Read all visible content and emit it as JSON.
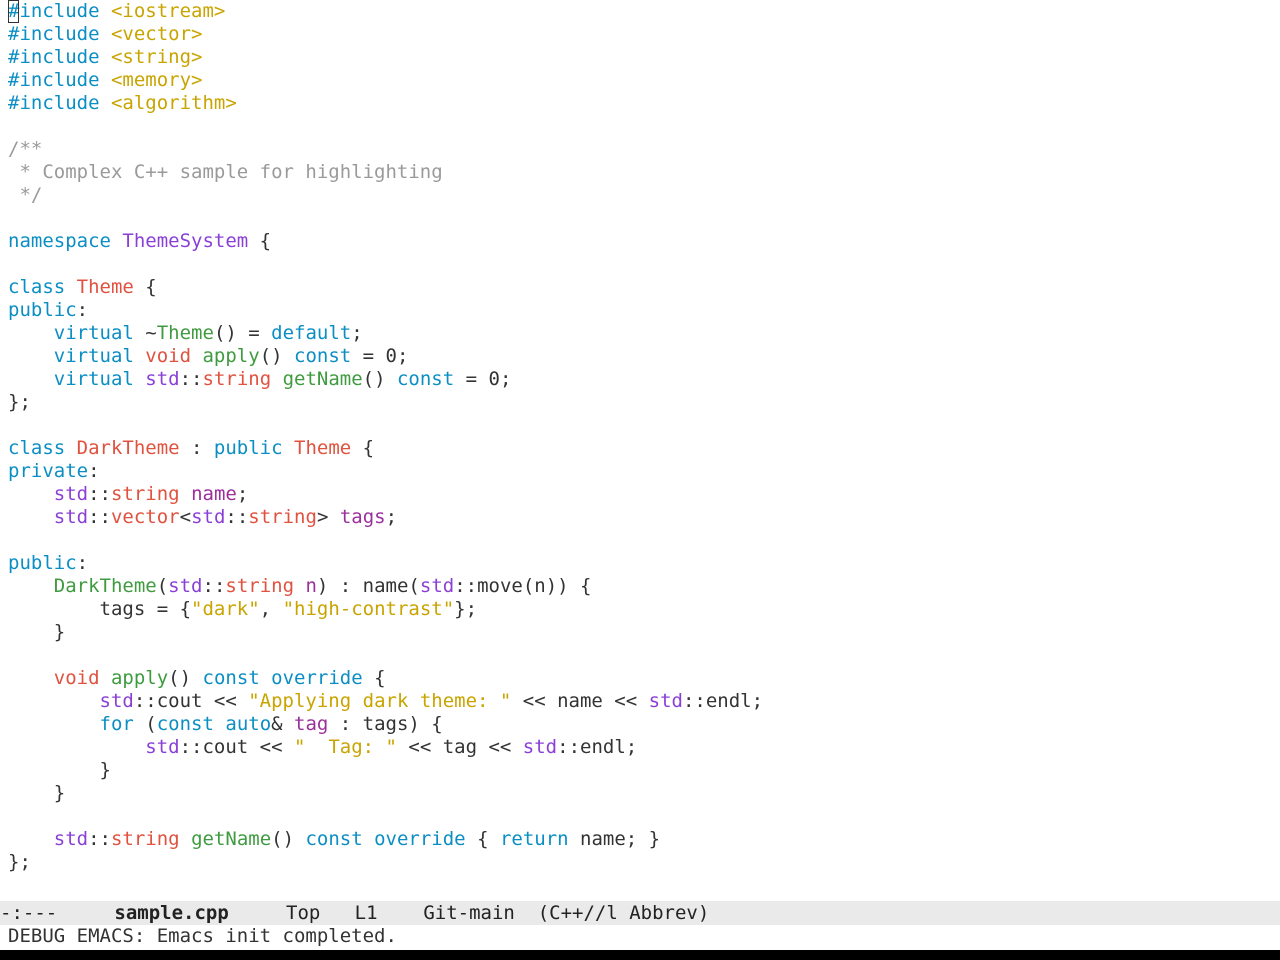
{
  "editor": {
    "lines": [
      [
        {
          "t": "#",
          "c": "kw",
          "cursor": true
        },
        {
          "t": "include ",
          "c": "kw"
        },
        {
          "t": "<iostream>",
          "c": "str"
        }
      ],
      [
        {
          "t": "#include ",
          "c": "kw"
        },
        {
          "t": "<vector>",
          "c": "str"
        }
      ],
      [
        {
          "t": "#include ",
          "c": "kw"
        },
        {
          "t": "<string>",
          "c": "str"
        }
      ],
      [
        {
          "t": "#include ",
          "c": "kw"
        },
        {
          "t": "<memory>",
          "c": "str"
        }
      ],
      [
        {
          "t": "#include ",
          "c": "kw"
        },
        {
          "t": "<algorithm>",
          "c": "str"
        }
      ],
      [],
      [
        {
          "t": "/**",
          "c": "com"
        }
      ],
      [
        {
          "t": " * Complex C++ sample for highlighting",
          "c": "com"
        }
      ],
      [
        {
          "t": " */",
          "c": "com"
        }
      ],
      [],
      [
        {
          "t": "namespace ",
          "c": "kw"
        },
        {
          "t": "ThemeSystem",
          "c": "ns"
        },
        {
          "t": " {",
          "c": "plain"
        }
      ],
      [],
      [
        {
          "t": "class ",
          "c": "kw"
        },
        {
          "t": "Theme",
          "c": "type"
        },
        {
          "t": " {",
          "c": "plain"
        }
      ],
      [
        {
          "t": "public",
          "c": "kw"
        },
        {
          "t": ":",
          "c": "plain"
        }
      ],
      [
        {
          "t": "    ",
          "c": "plain"
        },
        {
          "t": "virtual ",
          "c": "kw"
        },
        {
          "t": "~",
          "c": "plain"
        },
        {
          "t": "Theme",
          "c": "fn"
        },
        {
          "t": "() = ",
          "c": "plain"
        },
        {
          "t": "default",
          "c": "kw"
        },
        {
          "t": ";",
          "c": "plain"
        }
      ],
      [
        {
          "t": "    ",
          "c": "plain"
        },
        {
          "t": "virtual ",
          "c": "kw"
        },
        {
          "t": "void ",
          "c": "type"
        },
        {
          "t": "apply",
          "c": "fn"
        },
        {
          "t": "() ",
          "c": "plain"
        },
        {
          "t": "const",
          "c": "kw"
        },
        {
          "t": " = 0;",
          "c": "plain"
        }
      ],
      [
        {
          "t": "    ",
          "c": "plain"
        },
        {
          "t": "virtual ",
          "c": "kw"
        },
        {
          "t": "std",
          "c": "ns"
        },
        {
          "t": "::",
          "c": "plain"
        },
        {
          "t": "string ",
          "c": "type"
        },
        {
          "t": "getName",
          "c": "fn"
        },
        {
          "t": "() ",
          "c": "plain"
        },
        {
          "t": "const",
          "c": "kw"
        },
        {
          "t": " = 0;",
          "c": "plain"
        }
      ],
      [
        {
          "t": "};",
          "c": "plain"
        }
      ],
      [],
      [
        {
          "t": "class ",
          "c": "kw"
        },
        {
          "t": "DarkTheme",
          "c": "type"
        },
        {
          "t": " : ",
          "c": "plain"
        },
        {
          "t": "public ",
          "c": "kw"
        },
        {
          "t": "Theme",
          "c": "type"
        },
        {
          "t": " {",
          "c": "plain"
        }
      ],
      [
        {
          "t": "private",
          "c": "kw"
        },
        {
          "t": ":",
          "c": "plain"
        }
      ],
      [
        {
          "t": "    ",
          "c": "plain"
        },
        {
          "t": "std",
          "c": "ns"
        },
        {
          "t": "::",
          "c": "plain"
        },
        {
          "t": "string ",
          "c": "type"
        },
        {
          "t": "name",
          "c": "var"
        },
        {
          "t": ";",
          "c": "plain"
        }
      ],
      [
        {
          "t": "    ",
          "c": "plain"
        },
        {
          "t": "std",
          "c": "ns"
        },
        {
          "t": "::",
          "c": "plain"
        },
        {
          "t": "vector",
          "c": "type"
        },
        {
          "t": "<",
          "c": "plain"
        },
        {
          "t": "std",
          "c": "ns"
        },
        {
          "t": "::",
          "c": "plain"
        },
        {
          "t": "string",
          "c": "type"
        },
        {
          "t": "> ",
          "c": "plain"
        },
        {
          "t": "tags",
          "c": "var"
        },
        {
          "t": ";",
          "c": "plain"
        }
      ],
      [],
      [
        {
          "t": "public",
          "c": "kw"
        },
        {
          "t": ":",
          "c": "plain"
        }
      ],
      [
        {
          "t": "    ",
          "c": "plain"
        },
        {
          "t": "DarkTheme",
          "c": "fn"
        },
        {
          "t": "(",
          "c": "plain"
        },
        {
          "t": "std",
          "c": "ns"
        },
        {
          "t": "::",
          "c": "plain"
        },
        {
          "t": "string ",
          "c": "type"
        },
        {
          "t": "n",
          "c": "var"
        },
        {
          "t": ") : name(",
          "c": "plain"
        },
        {
          "t": "std",
          "c": "ns"
        },
        {
          "t": "::move(n)) {",
          "c": "plain"
        }
      ],
      [
        {
          "t": "        tags = {",
          "c": "plain"
        },
        {
          "t": "\"dark\"",
          "c": "str"
        },
        {
          "t": ", ",
          "c": "plain"
        },
        {
          "t": "\"high-contrast\"",
          "c": "str"
        },
        {
          "t": "};",
          "c": "plain"
        }
      ],
      [
        {
          "t": "    }",
          "c": "plain"
        }
      ],
      [],
      [
        {
          "t": "    ",
          "c": "plain"
        },
        {
          "t": "void ",
          "c": "type"
        },
        {
          "t": "apply",
          "c": "fn"
        },
        {
          "t": "() ",
          "c": "plain"
        },
        {
          "t": "const ",
          "c": "kw"
        },
        {
          "t": "override",
          "c": "kw"
        },
        {
          "t": " {",
          "c": "plain"
        }
      ],
      [
        {
          "t": "        ",
          "c": "plain"
        },
        {
          "t": "std",
          "c": "ns"
        },
        {
          "t": "::cout << ",
          "c": "plain"
        },
        {
          "t": "\"Applying dark theme: \"",
          "c": "str"
        },
        {
          "t": " << name << ",
          "c": "plain"
        },
        {
          "t": "std",
          "c": "ns"
        },
        {
          "t": "::endl;",
          "c": "plain"
        }
      ],
      [
        {
          "t": "        ",
          "c": "plain"
        },
        {
          "t": "for ",
          "c": "kw"
        },
        {
          "t": "(",
          "c": "plain"
        },
        {
          "t": "const ",
          "c": "kw"
        },
        {
          "t": "auto",
          "c": "kw"
        },
        {
          "t": "& ",
          "c": "plain"
        },
        {
          "t": "tag",
          "c": "var"
        },
        {
          "t": " : tags) {",
          "c": "plain"
        }
      ],
      [
        {
          "t": "            ",
          "c": "plain"
        },
        {
          "t": "std",
          "c": "ns"
        },
        {
          "t": "::cout << ",
          "c": "plain"
        },
        {
          "t": "\"  Tag: \"",
          "c": "str"
        },
        {
          "t": " << tag << ",
          "c": "plain"
        },
        {
          "t": "std",
          "c": "ns"
        },
        {
          "t": "::endl;",
          "c": "plain"
        }
      ],
      [
        {
          "t": "        }",
          "c": "plain"
        }
      ],
      [
        {
          "t": "    }",
          "c": "plain"
        }
      ],
      [],
      [
        {
          "t": "    ",
          "c": "plain"
        },
        {
          "t": "std",
          "c": "ns"
        },
        {
          "t": "::",
          "c": "plain"
        },
        {
          "t": "string ",
          "c": "type"
        },
        {
          "t": "getName",
          "c": "fn"
        },
        {
          "t": "() ",
          "c": "plain"
        },
        {
          "t": "const ",
          "c": "kw"
        },
        {
          "t": "override",
          "c": "kw"
        },
        {
          "t": " { ",
          "c": "plain"
        },
        {
          "t": "return",
          "c": "kw"
        },
        {
          "t": " name; }",
          "c": "plain"
        }
      ],
      [
        {
          "t": "};",
          "c": "plain"
        }
      ]
    ]
  },
  "mode_line": {
    "status": "-:---",
    "buffer_name": "sample.cpp",
    "position": "Top",
    "line": "L1",
    "vcs": "Git-main",
    "modes": "(C++//l Abbrev)"
  },
  "echo_area": {
    "message": "DEBUG EMACS: Emacs init completed."
  },
  "colors": {
    "keyword": "#0b8ec4",
    "type": "#e0523f",
    "string": "#c9a400",
    "comment": "#9a9a9a",
    "function": "#3f9b3f",
    "namespace": "#8a3fd6",
    "variable": "#9b2f9b",
    "mode_line_bg": "#eaeaea"
  }
}
